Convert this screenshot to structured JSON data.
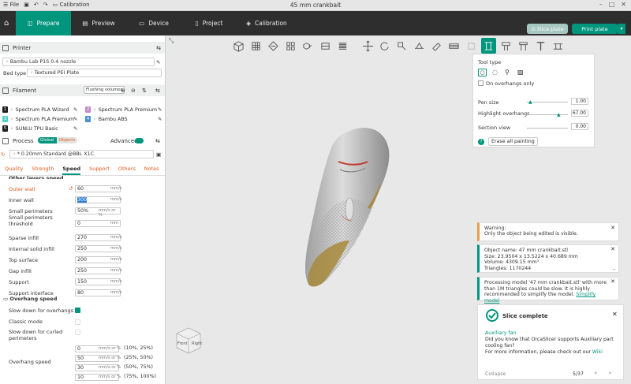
{
  "titlebar": {
    "file": "File",
    "calibration": "Calibration",
    "title": "45 mm crankbait"
  },
  "tabs": {
    "prepare": "Prepare",
    "preview": "Preview",
    "device": "Device",
    "project": "Project",
    "calibration": "Calibration",
    "slice": "Slice plate",
    "print": "Print plate"
  },
  "printer": {
    "heading": "Printer",
    "name": "Bambu Lab P1S 0.4 nozzle",
    "bed_label": "Bed type",
    "bed_value": "Textured PEI Plate"
  },
  "filament": {
    "heading": "Filament",
    "flushing": "Flushing volumes",
    "items": [
      {
        "num": "1",
        "name": "Spectrum PLA Wizard",
        "color": "#1e1e1e"
      },
      {
        "num": "2",
        "name": "Spectrum PLA Premium",
        "color": "#c58acb"
      },
      {
        "num": "3",
        "name": "Spectrum PLA Premium",
        "color": "#4fd1c5"
      },
      {
        "num": "4",
        "name": "Bambu ABS",
        "color": "#4a8fd0"
      },
      {
        "num": "5",
        "name": "SUNLU TPU Basic",
        "color": "#1e1e1e"
      }
    ]
  },
  "process": {
    "heading": "Process",
    "global": "Global",
    "objects": "Objects",
    "advanced": "Advanced",
    "profile": "* 0.20mm Standard @BBL X1C"
  },
  "process_tabs": [
    "Quality",
    "Strength",
    "Speed",
    "Support",
    "Others",
    "Notes"
  ],
  "speed": {
    "section_top": "Other layers speed",
    "rows": [
      {
        "label": "Outer wall",
        "value": "60",
        "unit": "mm/s"
      },
      {
        "label": "Inner wall",
        "value": "300",
        "unit": "mm/s"
      },
      {
        "label": "Small perimeters",
        "value": "50%",
        "unit": "mm/s or %"
      },
      {
        "label": "Small perimeters threshold",
        "value": "0",
        "unit": "mm"
      },
      {
        "label": "Sparse infill",
        "value": "270",
        "unit": "mm/s"
      },
      {
        "label": "Internal solid infill",
        "value": "250",
        "unit": "mm/s"
      },
      {
        "label": "Top surface",
        "value": "200",
        "unit": "mm/s"
      },
      {
        "label": "Gap infill",
        "value": "250",
        "unit": "mm/s"
      },
      {
        "label": "Support",
        "value": "150",
        "unit": "mm/s"
      },
      {
        "label": "Support interface",
        "value": "80",
        "unit": "mm/s"
      }
    ]
  },
  "overhang": {
    "heading": "Overhang speed",
    "slow_down": "Slow down for overhangs",
    "classic": "Classic mode",
    "curled": "Slow down for curled perimeters",
    "speed_label": "Overhang speed",
    "rows": [
      {
        "value": "0",
        "unit": "mm/s or %",
        "range": "(10%, 25%)"
      },
      {
        "value": "50",
        "unit": "mm/s or %",
        "range": "(25%, 50%)"
      },
      {
        "value": "30",
        "unit": "mm/s or %",
        "range": "(50%, 75%)"
      },
      {
        "value": "10",
        "unit": "mm/s or %",
        "range": "(75%, 100%)"
      }
    ]
  },
  "cube": {
    "front": "Front",
    "right": "Right"
  },
  "paint_panel": {
    "tool_type": "Tool type",
    "on_overhangs": "On overhangs only",
    "pen_size": "Pen size",
    "pen_value": "1.00",
    "highlight": "Highlight overhangs",
    "highlight_value": "67.00",
    "section": "Section view",
    "section_value": "0.00",
    "erase": "Erase all painting",
    "help": "?"
  },
  "notifications": {
    "warning": "Warning:",
    "warning_text": "Only the object being edited is visible.",
    "object_name": "Object name: 47 mm crankbait.stl",
    "size": "Size: 23.9504 x 13.5224 x 40.689 mm",
    "volume": "Volume: 4309.15 mm³",
    "triangles": "Triangles: 1170244",
    "processing": "Processing model '47 mm crankbait.stl' with more than 1M triangles could be slow. It is highly recommended to simplify the model.",
    "simplify": "Simplify model",
    "slice_complete": "Slice complete",
    "tip_title": "Auxiliary fan",
    "tip_text": "Did you know that OrcaSlicer supports Auxiliary part cooling fan?",
    "tip_more": "For more information, please check out our",
    "wiki": "Wiki",
    "collapse": "Collapse",
    "page": "5/37"
  }
}
